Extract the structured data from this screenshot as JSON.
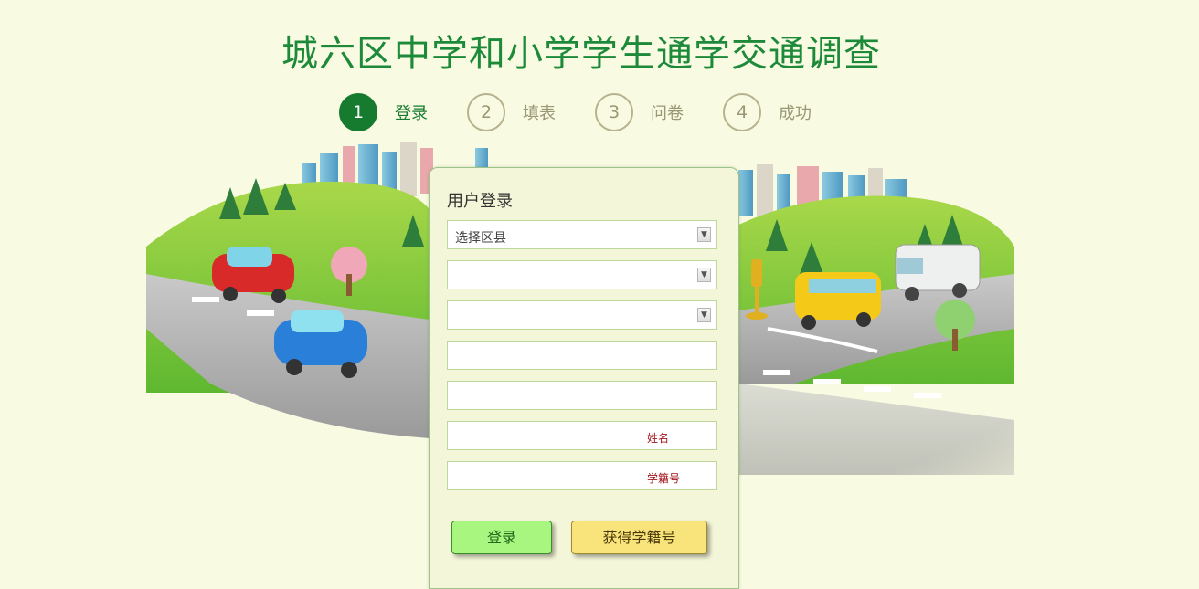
{
  "page": {
    "title": "城六区中学和小学学生通学交通调查"
  },
  "steps": [
    {
      "num": "1",
      "label": "登录",
      "active": true
    },
    {
      "num": "2",
      "label": "填表",
      "active": false
    },
    {
      "num": "3",
      "label": "问卷",
      "active": false
    },
    {
      "num": "4",
      "label": "成功",
      "active": false
    }
  ],
  "login": {
    "title": "用户登录",
    "district_select": {
      "value": "选择区县"
    },
    "school_select": {
      "value": ""
    },
    "grade_select": {
      "value": ""
    },
    "class_input": {
      "value": ""
    },
    "extra_input": {
      "value": ""
    },
    "name_input": {
      "value": "",
      "hint": "姓名"
    },
    "student_id_input": {
      "value": "",
      "hint": "学籍号"
    },
    "login_button": "登录",
    "get_id_button": "获得学籍号"
  },
  "colors": {
    "title_green": "#1d8a3a",
    "active_step": "#167a2f",
    "login_button": "#a8f57f",
    "get_id_button": "#f8e47b"
  }
}
